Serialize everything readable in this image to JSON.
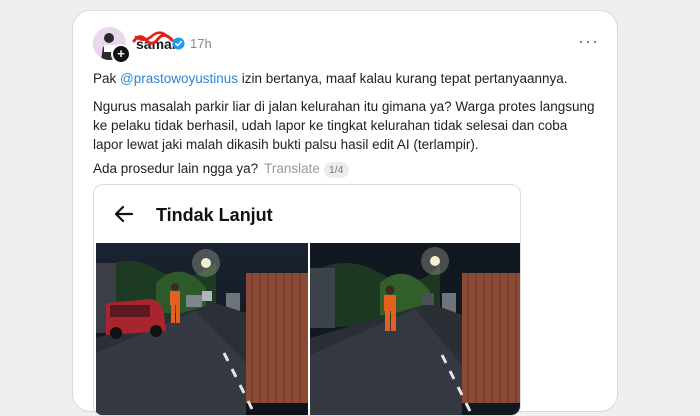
{
  "post": {
    "username": "saman",
    "timestamp": "17h",
    "more_label": "···",
    "follow_label": "+",
    "line1": {
      "prefix": "Pak ",
      "mention": "@prastowoyustinus",
      "suffix": " izin bertanya, maaf kalau kurang tepat pertanyaannya."
    },
    "line2": "Ngurus masalah parkir liar di jalan kelurahan itu gimana ya? Warga protes langsung ke pelaku tidak berhasil, udah lapor ke tingkat kelurahan tidak selesai dan coba lapor lewat jaki malah dikasih bukti palsu hasil edit AI (terlampir).",
    "line3": {
      "question": "Ada prosedur lain ngga ya?",
      "translate": "Translate",
      "counter": "1/4"
    }
  },
  "embed": {
    "title": "Tindak Lanjut"
  },
  "colors": {
    "mention": "#2a86d6",
    "verified": "#1d9bf0",
    "scribble": "#e0201b"
  }
}
